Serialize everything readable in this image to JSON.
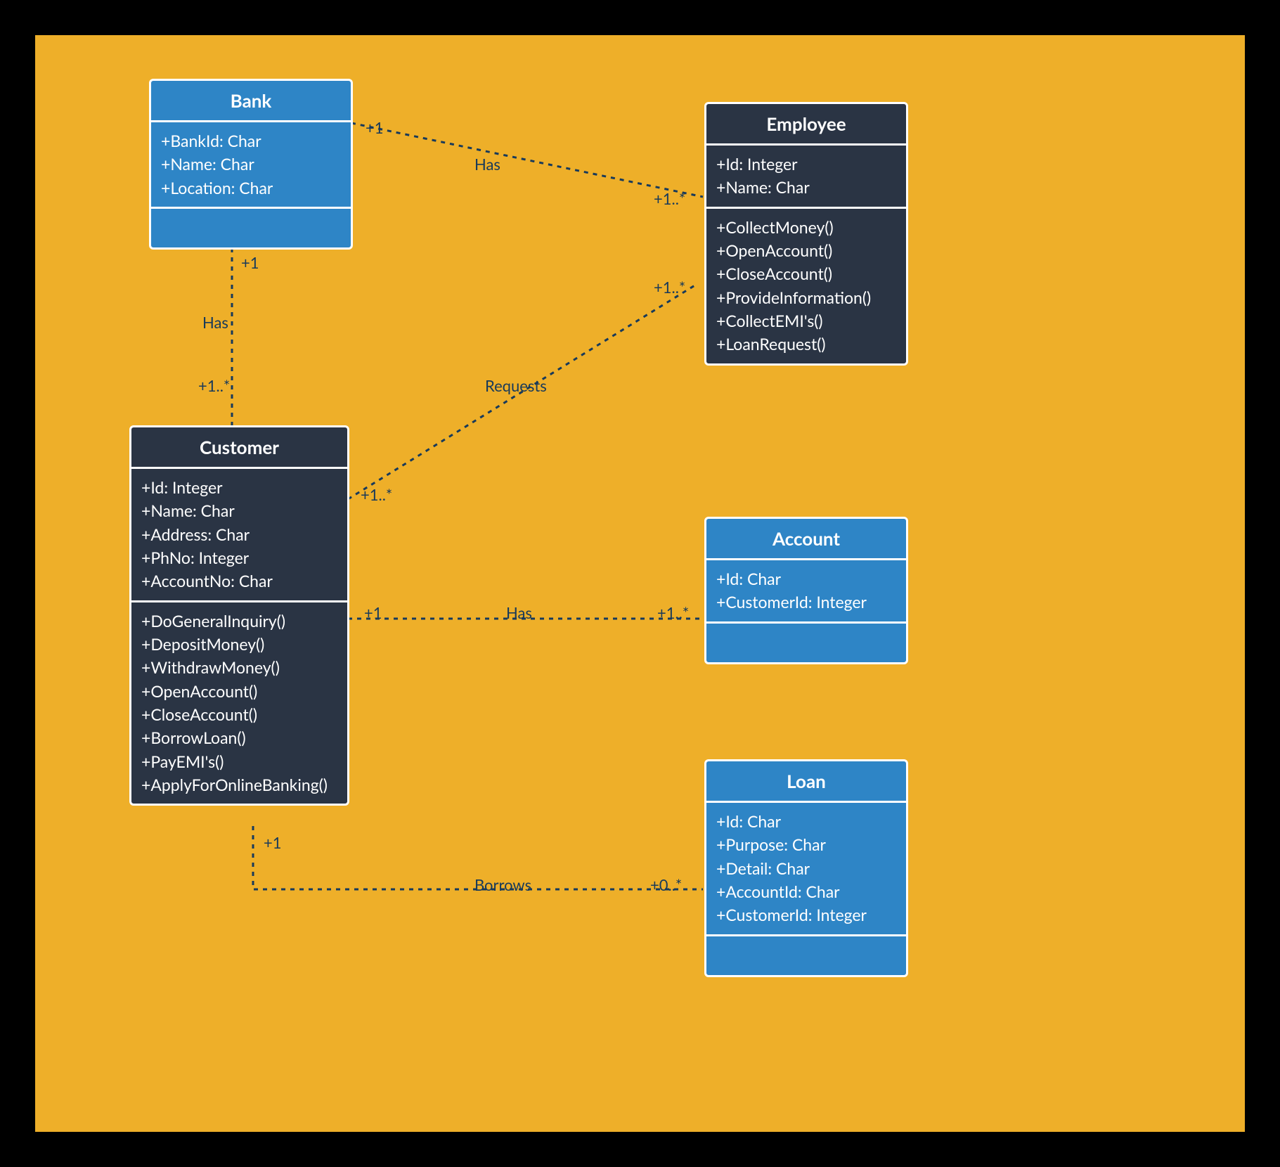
{
  "classes": {
    "bank": {
      "name": "Bank",
      "attrs": [
        "+BankId: Char",
        "+Name: Char",
        "+Location: Char"
      ],
      "ops": []
    },
    "employee": {
      "name": "Employee",
      "attrs": [
        "+Id: Integer",
        "+Name: Char"
      ],
      "ops": [
        "+CollectMoney()",
        "+OpenAccount()",
        "+CloseAccount()",
        "+ProvideInformation()",
        "+CollectEMI's()",
        "+LoanRequest()"
      ]
    },
    "customer": {
      "name": "Customer",
      "attrs": [
        "+Id: Integer",
        "+Name: Char",
        "+Address: Char",
        "+PhNo: Integer",
        "+AccountNo: Char"
      ],
      "ops": [
        "+DoGeneralInquiry()",
        "+DepositMoney()",
        "+WithdrawMoney()",
        "+OpenAccount()",
        "+CloseAccount()",
        "+BorrowLoan()",
        "+PayEMI's()",
        "+ApplyForOnlineBanking()"
      ]
    },
    "account": {
      "name": "Account",
      "attrs": [
        "+Id: Char",
        "+CustomerId: Integer"
      ],
      "ops": []
    },
    "loan": {
      "name": "Loan",
      "attrs": [
        "+Id: Char",
        "+Purpose: Char",
        "+Detail: Char",
        "+AccountId: Char",
        "+CustomerId: Integer"
      ],
      "ops": []
    }
  },
  "relations": {
    "bank_employee": {
      "label": "Has",
      "m1": "+1",
      "m2": "+1..*"
    },
    "bank_customer": {
      "label": "Has",
      "m1": "+1",
      "m2": "+1..*"
    },
    "customer_employee": {
      "label": "Requests",
      "m1": "+1..*",
      "m2": "+1..*"
    },
    "customer_account": {
      "label": "Has",
      "m1": "+1",
      "m2": "+1..*"
    },
    "customer_loan": {
      "label": "Borrows",
      "m1": "+1",
      "m2": "+0..*"
    }
  }
}
